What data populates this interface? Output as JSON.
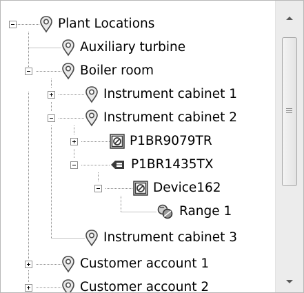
{
  "tree": {
    "nodes": [
      {
        "label": "Plant Locations",
        "icon": "location-pin-icon",
        "expander": "expanded"
      },
      {
        "label": "Auxiliary turbine",
        "icon": "location-pin-icon",
        "expander": "none"
      },
      {
        "label": "Boiler room",
        "icon": "location-pin-icon",
        "expander": "expanded"
      },
      {
        "label": "Instrument cabinet 1",
        "icon": "location-pin-icon",
        "expander": "collapsed"
      },
      {
        "label": "Instrument cabinet 2",
        "icon": "location-pin-icon",
        "expander": "expanded"
      },
      {
        "label": "P1BR9079TR",
        "icon": "device-icon",
        "expander": "collapsed"
      },
      {
        "label": "P1BR1435TX",
        "icon": "transmitter-icon",
        "expander": "expanded"
      },
      {
        "label": "Device162",
        "icon": "device-icon",
        "expander": "expanded"
      },
      {
        "label": "Range 1",
        "icon": "range-icon",
        "expander": "none"
      },
      {
        "label": "Instrument cabinet 3",
        "icon": "location-pin-icon",
        "expander": "none"
      },
      {
        "label": "Customer account 1",
        "icon": "location-pin-icon",
        "expander": "collapsed"
      },
      {
        "label": "Customer account 2",
        "icon": "location-pin-icon",
        "expander": "collapsed"
      }
    ]
  },
  "scrollbar": {
    "up_icon": "scroll-up-arrow-icon",
    "down_icon": "scroll-down-arrow-icon",
    "thumb_position": 0.0,
    "visible_fraction": 0.55
  },
  "colors": {
    "tree_lines": "#a0a0a0",
    "pin_fill": "#e9e9e9",
    "pin_stroke": "#4a4a4a",
    "device_frame": "#3a3a3a",
    "scroll_track": "#ececec"
  }
}
